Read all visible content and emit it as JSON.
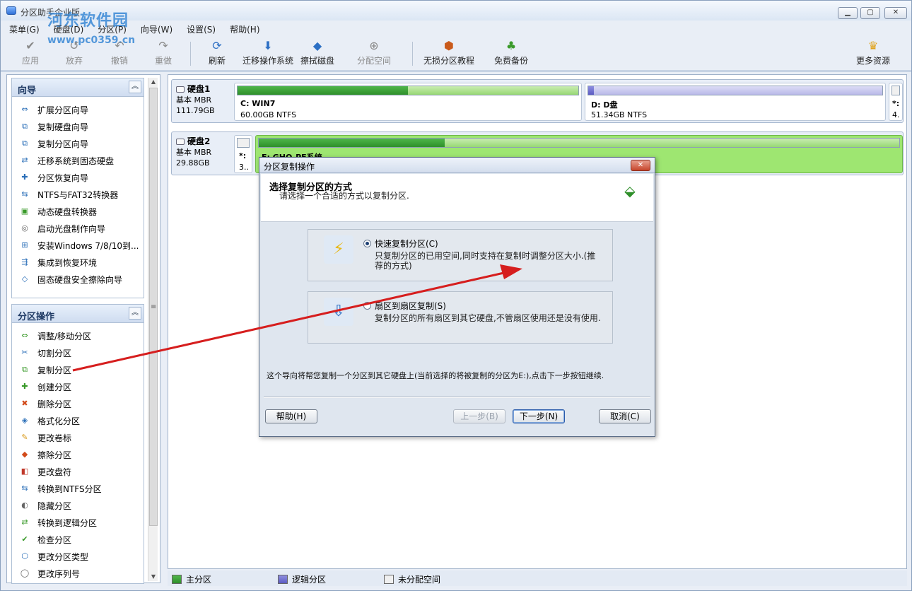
{
  "window": {
    "title": "分区助手企业版",
    "watermark_logo": "河东软件园",
    "watermark_url": "www.pc0359.cn"
  },
  "menu": [
    "菜单(G)",
    "硬盘(D)",
    "分区(P)",
    "向导(W)",
    "设置(S)",
    "帮助(H)"
  ],
  "toolbar": {
    "apply": "应用",
    "discard": "放弃",
    "undo": "撤销",
    "redo": "重做",
    "refresh": "刷新",
    "migrate_os": "迁移操作系统",
    "wipe_disk": "擦拭磁盘",
    "allocate_space": "分配空间",
    "lossless_tutorial": "无损分区教程",
    "free_backup": "免费备份",
    "more_resources": "更多资源"
  },
  "sidebar": {
    "wizard": {
      "title": "向导",
      "items": [
        "扩展分区向导",
        "复制硬盘向导",
        "复制分区向导",
        "迁移系统到固态硬盘",
        "分区恢复向导",
        "NTFS与FAT32转换器",
        "动态硬盘转换器",
        "启动光盘制作向导",
        "安装Windows 7/8/10到...",
        "集成到恢复环境",
        "固态硬盘安全擦除向导"
      ]
    },
    "partition_ops": {
      "title": "分区操作",
      "items": [
        "调整/移动分区",
        "切割分区",
        "复制分区",
        "创建分区",
        "删除分区",
        "格式化分区",
        "更改卷标",
        "擦除分区",
        "更改盘符",
        "转换到NTFS分区",
        "隐藏分区",
        "转换到逻辑分区",
        "检查分区",
        "更改分区类型",
        "更改序列号"
      ]
    }
  },
  "disks": [
    {
      "name": "硬盘1",
      "type": "基本 MBR",
      "size": "111.79GB",
      "partitions": [
        {
          "name": "C: WIN7",
          "size": "60.00GB NTFS",
          "kind": "primary",
          "used_fraction": 0.5
        },
        {
          "name": "D: D盘",
          "size": "51.34GB NTFS",
          "kind": "logical",
          "used_fraction": 0.02
        },
        {
          "name": "*:",
          "size": "4.",
          "kind": "unallocated",
          "used_fraction": 0
        }
      ]
    },
    {
      "name": "硬盘2",
      "type": "基本 MBR",
      "size": "29.88GB",
      "partitions": [
        {
          "name": "*:",
          "size": "3..",
          "kind": "unallocated",
          "used_fraction": 0
        },
        {
          "name": "E: GHO-PE系统",
          "size": "",
          "kind": "primary",
          "used_fraction": 0.29
        }
      ]
    }
  ],
  "legend": {
    "primary": "主分区",
    "logical": "逻辑分区",
    "unallocated": "未分配空间"
  },
  "dialog": {
    "title": "分区复制操作",
    "header_title": "选择复制分区的方式",
    "header_subtitle": "请选择一个合适的方式以复制分区.",
    "option_fast_label": "快速复制分区(C)",
    "option_fast_desc": "只复制分区的已用空间,同时支持在复制时调整分区大小.(推荐的方式)",
    "option_fast_selected": true,
    "option_sector_label": "扇区到扇区复制(S)",
    "option_sector_desc": "复制分区的所有扇区到其它硬盘,不管扇区使用还是没有使用.",
    "info": "这个导向将帮您复制一个分区到其它硬盘上(当前选择的将被复制的分区为E:),点击下一步按钮继续.",
    "help_button": "帮助(H)",
    "prev_button": "上一步(B)",
    "next_button": "下一步(N)",
    "cancel_button": "取消(C)"
  },
  "colors": {
    "primary_fill": "#2e8f2a",
    "logical_fill": "#5b5bc2",
    "selected_partition": "#9ee671",
    "annotation_arrow": "#d61e1e"
  }
}
